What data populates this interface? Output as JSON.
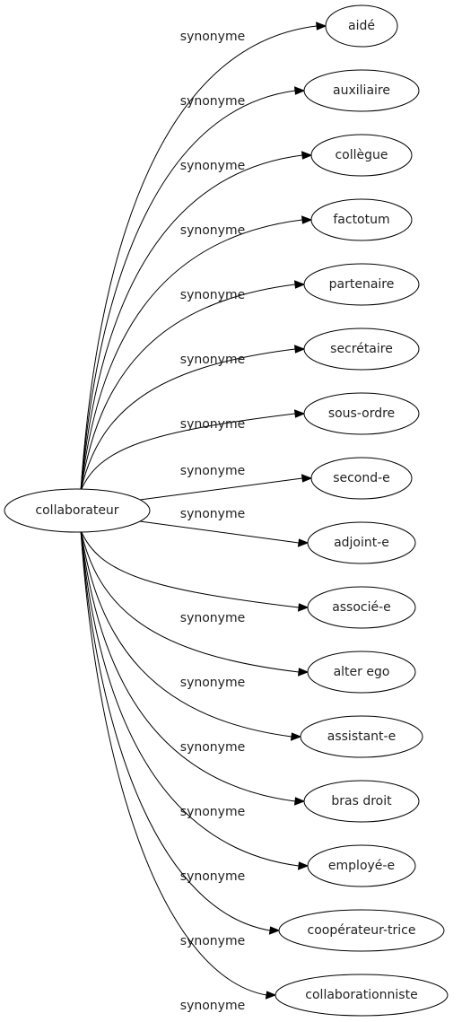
{
  "graph": {
    "source": {
      "id": "collaborateur",
      "label": "collaborateur"
    },
    "relation_label": "synonyme",
    "targets": [
      {
        "id": "aide",
        "label": "aidé"
      },
      {
        "id": "auxiliaire",
        "label": "auxiliaire"
      },
      {
        "id": "collegue",
        "label": "collègue"
      },
      {
        "id": "factotum",
        "label": "factotum"
      },
      {
        "id": "partenaire",
        "label": "partenaire"
      },
      {
        "id": "secretaire",
        "label": "secrétaire"
      },
      {
        "id": "sous-ordre",
        "label": "sous-ordre"
      },
      {
        "id": "second-e",
        "label": "second-e"
      },
      {
        "id": "adjoint-e",
        "label": "adjoint-e"
      },
      {
        "id": "associe-e",
        "label": "associé-e"
      },
      {
        "id": "alter-ego",
        "label": "alter ego"
      },
      {
        "id": "assistant-e",
        "label": "assistant-e"
      },
      {
        "id": "bras-droit",
        "label": "bras droit"
      },
      {
        "id": "employe-e",
        "label": "employé-e"
      },
      {
        "id": "cooperateur-trice",
        "label": "coopérateur-trice"
      },
      {
        "id": "collaborationniste",
        "label": "collaborationniste"
      }
    ],
    "edges": [
      {
        "from": "collaborateur",
        "to": "aide",
        "label": "synonyme"
      },
      {
        "from": "collaborateur",
        "to": "auxiliaire",
        "label": "synonyme"
      },
      {
        "from": "collaborateur",
        "to": "collegue",
        "label": "synonyme"
      },
      {
        "from": "collaborateur",
        "to": "factotum",
        "label": "synonyme"
      },
      {
        "from": "collaborateur",
        "to": "partenaire",
        "label": "synonyme"
      },
      {
        "from": "collaborateur",
        "to": "secretaire",
        "label": "synonyme"
      },
      {
        "from": "collaborateur",
        "to": "sous-ordre",
        "label": "synonyme"
      },
      {
        "from": "collaborateur",
        "to": "second-e",
        "label": "synonyme"
      },
      {
        "from": "collaborateur",
        "to": "adjoint-e",
        "label": "synonyme"
      },
      {
        "from": "collaborateur",
        "to": "associe-e",
        "label": "synonyme"
      },
      {
        "from": "collaborateur",
        "to": "alter-ego",
        "label": "synonyme"
      },
      {
        "from": "collaborateur",
        "to": "assistant-e",
        "label": "synonyme"
      },
      {
        "from": "collaborateur",
        "to": "bras-droit",
        "label": "synonyme"
      },
      {
        "from": "collaborateur",
        "to": "employe-e",
        "label": "synonyme"
      },
      {
        "from": "collaborateur",
        "to": "cooperateur-trice",
        "label": "synonyme"
      },
      {
        "from": "collaborateur",
        "to": "collaborationniste",
        "label": "synonyme"
      }
    ]
  }
}
